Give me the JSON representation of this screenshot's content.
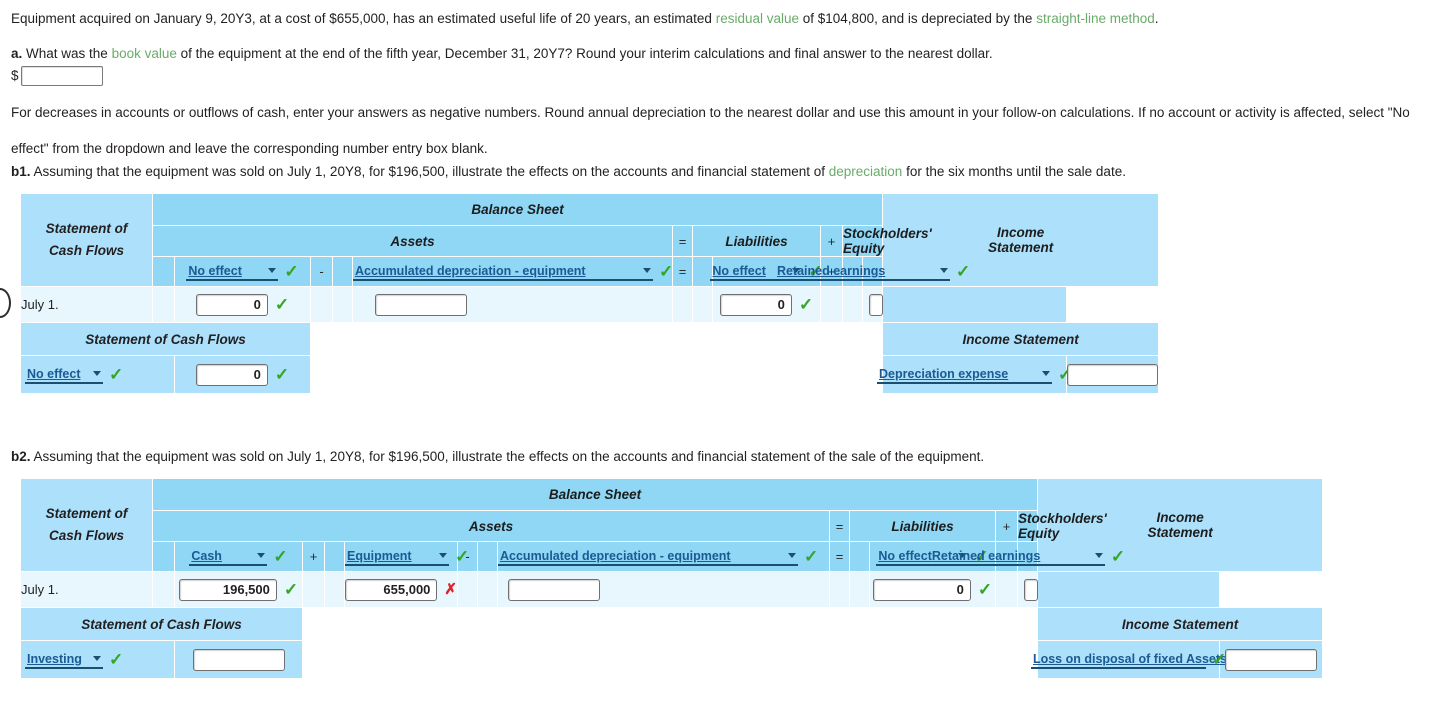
{
  "intro": {
    "part1": "Equipment acquired on January 9, 20Y3, at a cost of $655,000, has an estimated useful life of 20 years, an estimated ",
    "link1": "residual value",
    "part2": " of $104,800, and is depreciated by the ",
    "link2": "straight-line method",
    "part3": "."
  },
  "question_a": {
    "marker": "a.",
    "part1": "  What was the ",
    "link": "book value",
    "part2": " of the equipment at the end of the fifth year, December 31, 20Y7? Round your interim calculations and final answer to the nearest dollar.",
    "dollar_sign": "$",
    "answer_value": ""
  },
  "note": {
    "line1": "For decreases in accounts or outflows of cash, enter your answers as negative numbers. Round annual depreciation to the nearest dollar and use this amount in your follow-on calculations. If no account or activity is affected, select \"No",
    "line2": "effect\" from the dropdown and leave the corresponding number entry box blank."
  },
  "b1": {
    "marker": "b1.",
    "text_part1": "  Assuming that the equipment was sold on July 1, 20Y8, for $196,500, illustrate the effects on the accounts and financial statement of ",
    "link": "depreciation",
    "text_part2": " for the six months until the sale date.",
    "headers": {
      "statement_of": "Statement of",
      "cash_flows": "Cash Flows",
      "balance_sheet": "Balance Sheet",
      "assets": "Assets",
      "liabilities": "Liabilities",
      "stockholders_equity": "Stockholders' Equity",
      "income": "Income",
      "statement": "Statement",
      "eq1": "=",
      "plus1": "+"
    },
    "selects": {
      "asset1": "No effect",
      "op_minus": "-",
      "asset2": "Accumulated depreciation - equipment",
      "op_eq": "=",
      "liability": "No effect",
      "op_plus": "+",
      "equity": "Retained earnings"
    },
    "row": {
      "date": "July 1.",
      "asset1_value": "0",
      "asset2_value": "",
      "liability_value": "0",
      "equity_value": "",
      "income_value": ""
    },
    "footer": {
      "scf_title": "Statement of Cash Flows",
      "is_title": "Income Statement",
      "scf_select": "No effect",
      "scf_value": "0",
      "is_select": "Depreciation expense",
      "is_value": ""
    }
  },
  "b2": {
    "marker": "b2.",
    "text": "  Assuming that the equipment was sold on July 1, 20Y8, for $196,500, illustrate the effects on the accounts and financial statement of the sale of the equipment.",
    "headers": {
      "statement_of": "Statement of",
      "cash_flows": "Cash Flows",
      "balance_sheet": "Balance Sheet",
      "assets": "Assets",
      "liabilities": "Liabilities",
      "stockholders_equity": "Stockholders' Equity",
      "income": "Income",
      "statement": "Statement",
      "eq1": "=",
      "plus1": "+"
    },
    "selects": {
      "asset1": "Cash",
      "op_plus_1": "+",
      "asset2": "Equipment",
      "op_minus": "-",
      "asset3": "Accumulated depreciation - equipment",
      "op_eq": "=",
      "liability": "No effect",
      "equity": "Retained earnings"
    },
    "row": {
      "date": "July 1.",
      "asset1_value": "196,500",
      "asset1_status": "correct",
      "asset2_value": "655,000",
      "asset2_status": "incorrect",
      "asset3_value": "",
      "liability_value": "0",
      "equity_value": ""
    },
    "footer": {
      "scf_title": "Statement of Cash Flows",
      "is_title": "Income Statement",
      "scf_select": "Investing",
      "scf_value": "",
      "is_select": "Loss on disposal of fixed Assets",
      "is_value": ""
    }
  },
  "icons": {
    "check": "✓",
    "cross": "✗",
    "caret": "dropdown-caret"
  },
  "colors": {
    "header_blue": "#8fd7f5",
    "light_blue": "#ace0fb",
    "row_blue": "#e8f6fd",
    "link_green": "#6aab6a",
    "select_text": "#1b5a92",
    "check_green": "#34a524",
    "cross_red": "#e22128"
  }
}
